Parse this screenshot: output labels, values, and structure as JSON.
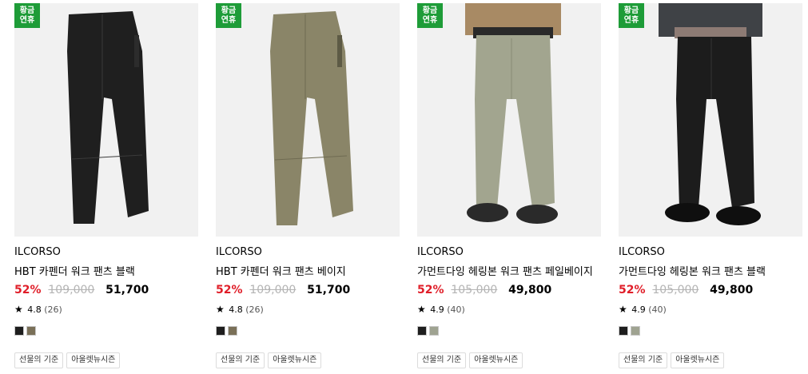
{
  "products": [
    {
      "badge": [
        "황금",
        "연휴"
      ],
      "brand": "ILCORSO",
      "name": "HBT 카펜더 워크 팬츠 블랙",
      "discount": "52%",
      "original_price": "109,000",
      "sale_price": "51,700",
      "rating": "4.8",
      "review_count": "(26)",
      "swatches": [
        "#1e1e1e",
        "#7a7058"
      ],
      "tags": [
        "선물의 기준",
        "아울렛뉴시즌"
      ],
      "image_icon": "black-work-pants-photo",
      "pant_color": "#1f1f1f"
    },
    {
      "badge": [
        "황금",
        "연휴"
      ],
      "brand": "ILCORSO",
      "name": "HBT 카펜더 워크 팬츠 베이지",
      "discount": "52%",
      "original_price": "109,000",
      "sale_price": "51,700",
      "rating": "4.8",
      "review_count": "(26)",
      "swatches": [
        "#1e1e1e",
        "#7a7058"
      ],
      "tags": [
        "선물의 기준",
        "아울렛뉴시즌"
      ],
      "image_icon": "beige-work-pants-photo",
      "pant_color": "#8a8568"
    },
    {
      "badge": [
        "황금",
        "연휴"
      ],
      "brand": "ILCORSO",
      "name": "가먼트다잉 헤링본 워크 팬츠 페일베이지",
      "discount": "52%",
      "original_price": "105,000",
      "sale_price": "49,800",
      "rating": "4.9",
      "review_count": "(40)",
      "swatches": [
        "#1e1e1e",
        "#9fa391"
      ],
      "tags": [
        "선물의 기준",
        "아울렛뉴시즌"
      ],
      "image_icon": "pale-beige-pants-model-photo",
      "pant_color": "#a2a58f"
    },
    {
      "badge": [
        "황금",
        "연휴"
      ],
      "brand": "ILCORSO",
      "name": "가먼트다잉 헤링본 워크 팬츠 블랙",
      "discount": "52%",
      "original_price": "105,000",
      "sale_price": "49,800",
      "rating": "4.9",
      "review_count": "(40)",
      "swatches": [
        "#1e1e1e",
        "#9fa391"
      ],
      "tags": [
        "선물의 기준",
        "아울렛뉴시즌"
      ],
      "image_icon": "black-pants-model-photo",
      "pant_color": "#1c1c1c"
    }
  ]
}
